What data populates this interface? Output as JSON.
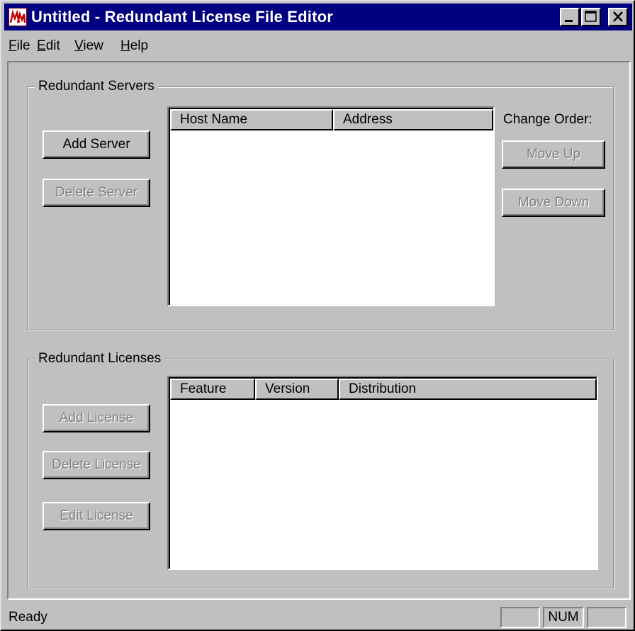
{
  "window": {
    "title": "Untitled - Redundant License File Editor",
    "app_icon": "lm-app-icon",
    "controls": [
      "minimize-icon",
      "maximize-icon",
      "close-icon"
    ]
  },
  "menu": [
    {
      "label": "File"
    },
    {
      "label": "Edit"
    },
    {
      "label": "View"
    },
    {
      "label": "Help"
    }
  ],
  "servers": {
    "group_label": "Redundant Servers",
    "add_button": "Add Server",
    "delete_button": "Delete Server",
    "columns": [
      "Host Name",
      "Address"
    ],
    "rows": [],
    "change_order_label": "Change Order:",
    "move_up_button": "Move Up",
    "move_down_button": "Move Down"
  },
  "licenses": {
    "group_label": "Redundant Licenses",
    "add_button": "Add License",
    "delete_button": "Delete License",
    "edit_button": "Edit License",
    "columns": [
      "Feature",
      "Version",
      "Distribution"
    ],
    "rows": []
  },
  "status": {
    "text": "Ready",
    "num_indicator": "NUM"
  },
  "colors": {
    "title_bar": "#000080",
    "face": "#c0c0c0",
    "disabled_text": "#808080"
  }
}
